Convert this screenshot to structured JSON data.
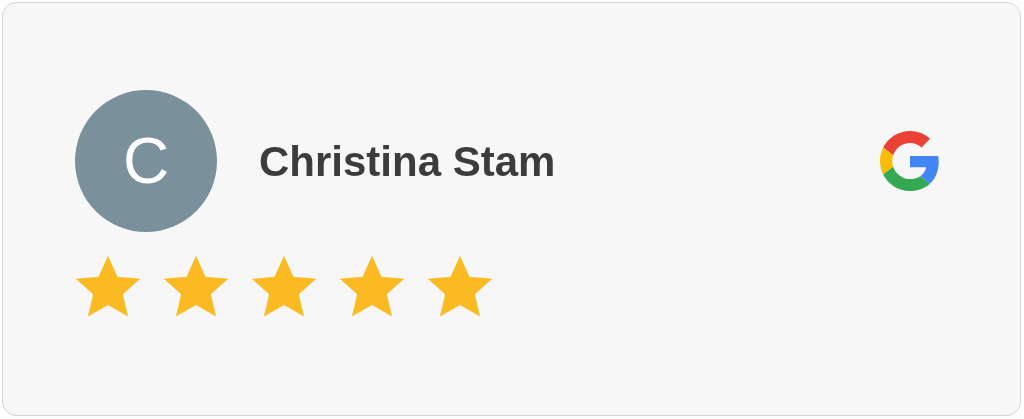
{
  "review": {
    "avatar_initial": "C",
    "author": "Christina Stam",
    "stars": 5
  }
}
